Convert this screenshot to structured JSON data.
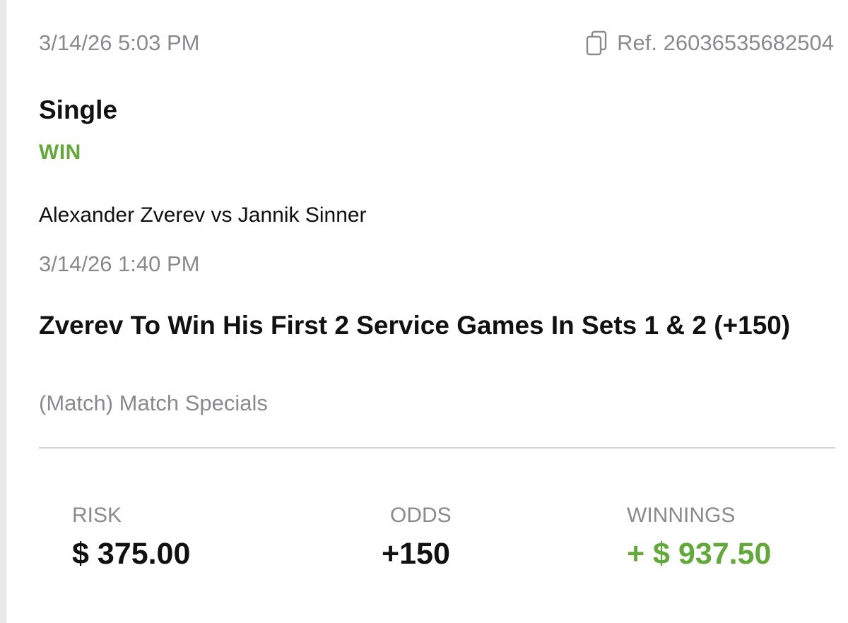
{
  "bet": {
    "placed_time": "3/14/26 5:03 PM",
    "ref_label": "Ref. 26036535682504",
    "type": "Single",
    "result": "WIN",
    "event_name": "Alexander Zverev vs Jannik Sinner",
    "event_time": "3/14/26 1:40 PM",
    "selection": "Zverev To Win His First 2 Service Games In Sets 1 & 2 (+150)",
    "market": "(Match) Match Specials"
  },
  "stats": {
    "risk_label": "RISK",
    "risk_value": "$ 375.00",
    "odds_label": "ODDS",
    "odds_value": "+150",
    "winnings_label": "WINNINGS",
    "winnings_value": "+ $ 937.50"
  },
  "colors": {
    "win_green": "#62a93a",
    "muted_gray": "#8a8a8e",
    "text": "#111111"
  },
  "icons": {
    "copy": "copy-icon"
  }
}
